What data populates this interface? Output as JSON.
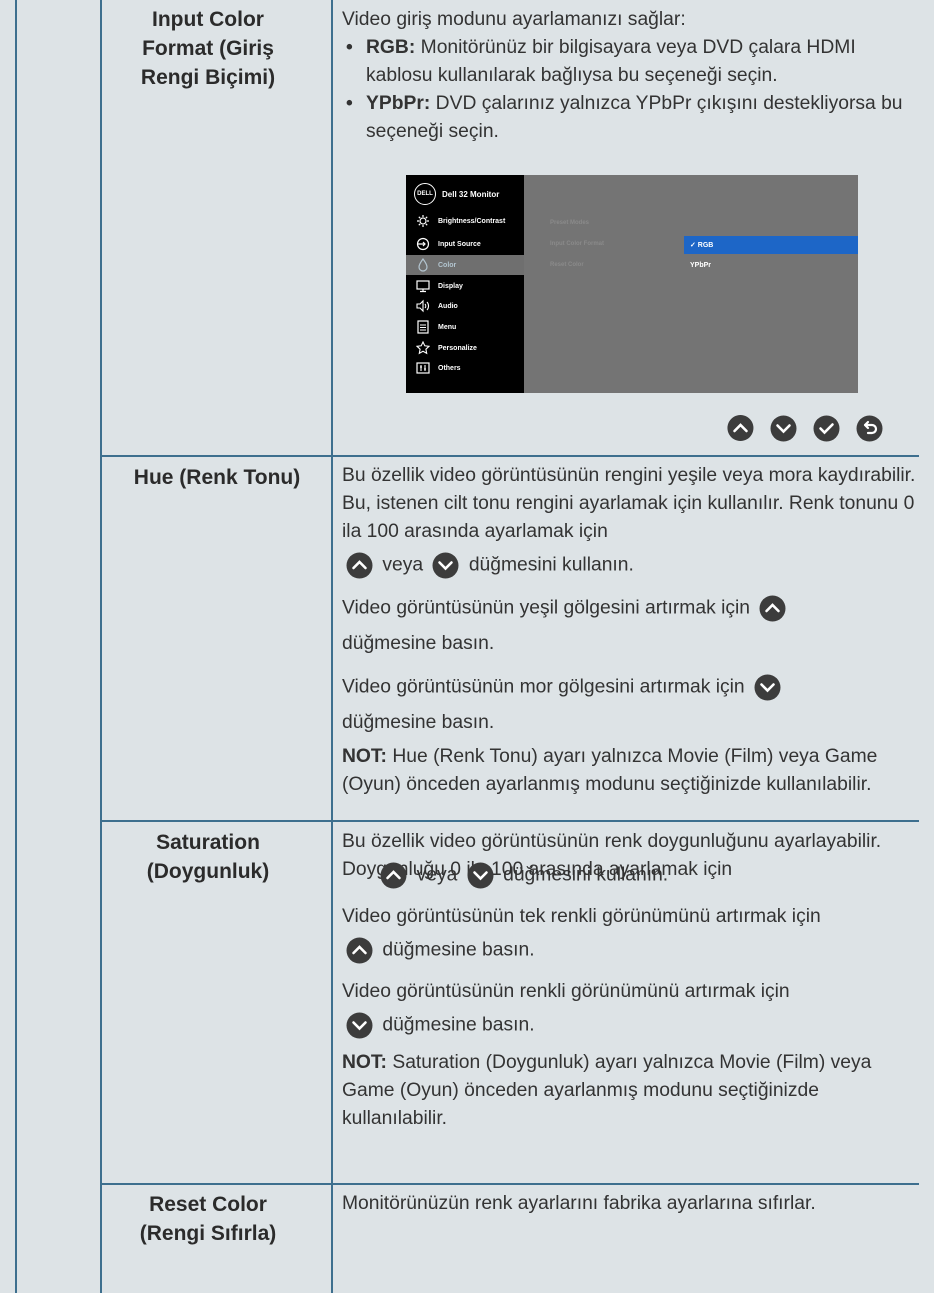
{
  "rows": [
    {
      "label": "Input Color Format (Giriş Rengi Biçimi)",
      "intro": "Video giriş modunu ayarlamanızı sağlar:",
      "bullets": [
        {
          "term": "RGB:",
          "text": " Monitörünüz bir bilgisayara veya DVD çalara HDMI kablosu kullanılarak bağlıysa bu seçeneği seçin."
        },
        {
          "term": "YPbPr:",
          "text": " DVD çalarınız yalnızca YPbPr çıkışını destekliyorsa bu seçeneği seçin."
        }
      ]
    },
    {
      "label": "Hue (Renk Tonu)",
      "p1a": "Bu özellik video görüntüsünün rengini yeşile veya mora kaydırabilir. Bu, istenen cilt tonu rengini ayarlamak için kullanılır. Renk tonunu 0 ila 100 arasında ayarlamak için",
      "p1b": "veya",
      "p1c": "düğmesini kullanın.",
      "p2a": "Video görüntüsünün yeşil gölgesini artırmak için",
      "p2b": "düğmesine basın.",
      "p3a": "Video görüntüsünün mor gölgesini artırmak için",
      "p3b": "düğmesine basın.",
      "note_label": "NOT:",
      "note": " Hue (Renk Tonu) ayarı yalnızca Movie (Film) veya Game (Oyun) önceden ayarlanmış modunu seçtiğinizde kullanılabilir."
    },
    {
      "label": "Saturation (Doygunluk)",
      "p1a": "Bu özellik video görüntüsünün renk doygunluğunu ayarlayabilir. Doygunluğu 0 ila 100 arasında ayarlamak için",
      "p1b": "veya",
      "p1c": "düğmesini kullanın.",
      "p2a": "Video görüntüsünün tek renkli görünümünü artırmak için",
      "p2b": "düğmesine basın.",
      "p3a": "Video görüntüsünün renkli görünümünü artırmak için",
      "p3b": "düğmesine basın.",
      "note_label": "NOT:",
      "note": " Saturation (Doygunluk) ayarı yalnızca Movie (Film) veya Game (Oyun) önceden ayarlanmış modunu seçtiğinizde kullanılabilir."
    },
    {
      "label": "Reset Color (Rengi Sıfırla)",
      "desc": "Monitörünüzün renk ayarlarını fabrika ayarlarına sıfırlar."
    }
  ],
  "osd": {
    "logo": "DELL",
    "title": "Dell 32 Monitor",
    "menu": [
      {
        "label": "Brightness/Contrast",
        "icon": "brightness-icon",
        "active": false
      },
      {
        "label": "Input Source",
        "icon": "input-source-icon",
        "active": false
      },
      {
        "label": "Color",
        "icon": "color-icon",
        "active": true
      },
      {
        "label": "Display",
        "icon": "display-icon",
        "active": false
      },
      {
        "label": "Audio",
        "icon": "audio-icon",
        "active": false
      },
      {
        "label": "Menu",
        "icon": "menu-icon",
        "active": false
      },
      {
        "label": "Personalize",
        "icon": "star-icon",
        "active": false
      },
      {
        "label": "Others",
        "icon": "others-icon",
        "active": false
      }
    ],
    "submenu": [
      "Preset Modes",
      "Input Color Format",
      "Reset Color"
    ],
    "options": [
      {
        "label": "✓ RGB",
        "selected": true
      },
      {
        "label": "YPbPr",
        "selected": false
      }
    ],
    "accent": "#1d66c7"
  },
  "colors": {
    "border": "#3d6f8e",
    "background": "#dde3e6",
    "button": "#3c3c3c"
  }
}
